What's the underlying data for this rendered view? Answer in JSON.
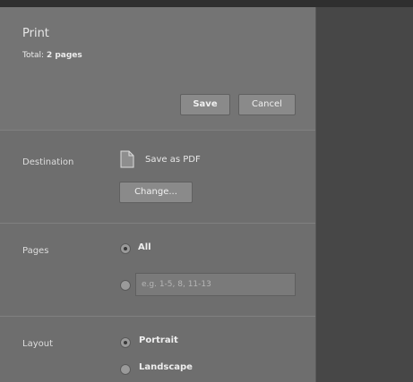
{
  "header": {
    "title": "Print",
    "summary_prefix": "Total:",
    "summary_bold": "2 pages"
  },
  "buttons": {
    "save": "Save",
    "cancel": "Cancel",
    "change": "Change..."
  },
  "destination": {
    "label": "Destination",
    "name": "Save as PDF",
    "icon": "document-icon"
  },
  "pages": {
    "label": "Pages",
    "all_label": "All",
    "selected": "all",
    "range_placeholder": "e.g. 1-5, 8, 11-13",
    "range_value": ""
  },
  "layout": {
    "label": "Layout",
    "portrait_label": "Portrait",
    "landscape_label": "Landscape",
    "selected": "portrait"
  }
}
